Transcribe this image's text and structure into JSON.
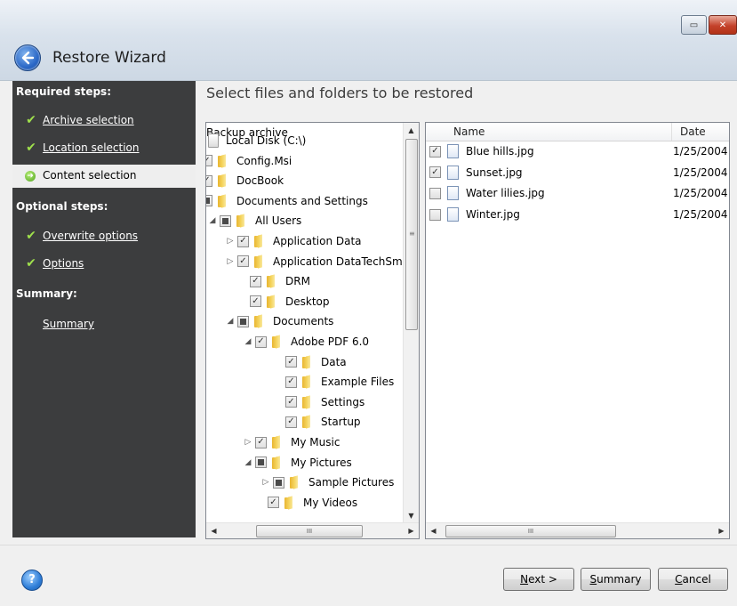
{
  "window": {
    "title": "Restore Wizard",
    "controls": [
      "minimize",
      "close"
    ]
  },
  "sidebar": {
    "required_heading": "Required steps:",
    "required_items": [
      {
        "label": "Archive selection",
        "status": "done"
      },
      {
        "label": "Location selection",
        "status": "done"
      },
      {
        "label": "Content selection",
        "status": "current"
      }
    ],
    "optional_heading": "Optional steps:",
    "optional_items": [
      {
        "label": "Overwrite options",
        "status": "done"
      },
      {
        "label": "Options",
        "status": "done"
      }
    ],
    "summary_heading": "Summary:",
    "summary_link": "Summary"
  },
  "content": {
    "title": "Select files and folders to be restored"
  },
  "tree": {
    "rows": [
      {
        "label": "Backup archive",
        "icon": "none",
        "check": "none",
        "expander": "none"
      },
      {
        "label": "Local Disk (C:\\)",
        "icon": "disk-icon",
        "check": "none",
        "expander": "none"
      },
      {
        "label": "Config.Msi",
        "icon": "folder-icon",
        "check": "checked",
        "expander": "none"
      },
      {
        "label": "DocBook",
        "icon": "folder-icon",
        "check": "checked",
        "expander": "none"
      },
      {
        "label": "Documents and Settings",
        "icon": "folder-icon",
        "check": "partial",
        "expander": "none"
      },
      {
        "label": "All Users",
        "icon": "folder-icon",
        "check": "partial",
        "expander": "expanded"
      },
      {
        "label": "Application Data",
        "icon": "folder-icon",
        "check": "checked",
        "expander": "collapsed"
      },
      {
        "label": "Application DataTechSm",
        "icon": "folder-icon",
        "check": "checked",
        "expander": "collapsed"
      },
      {
        "label": "DRM",
        "icon": "folder-icon",
        "check": "checked",
        "expander": "none"
      },
      {
        "label": "Desktop",
        "icon": "folder-icon",
        "check": "checked",
        "expander": "none"
      },
      {
        "label": "Documents",
        "icon": "folder-icon",
        "check": "partial",
        "expander": "expanded"
      },
      {
        "label": "Adobe PDF 6.0",
        "icon": "folder-icon",
        "check": "checked",
        "expander": "expanded"
      },
      {
        "label": "Data",
        "icon": "folder-icon",
        "check": "checked",
        "expander": "none"
      },
      {
        "label": "Example Files",
        "icon": "folder-icon",
        "check": "checked",
        "expander": "none"
      },
      {
        "label": "Settings",
        "icon": "folder-icon",
        "check": "checked",
        "expander": "none"
      },
      {
        "label": "Startup",
        "icon": "folder-icon",
        "check": "checked",
        "expander": "none"
      },
      {
        "label": "My Music",
        "icon": "folder-icon",
        "check": "checked",
        "expander": "collapsed"
      },
      {
        "label": "My Pictures",
        "icon": "folder-icon",
        "check": "partial",
        "expander": "expanded"
      },
      {
        "label": "Sample Pictures",
        "icon": "folder-icon",
        "check": "partial",
        "expander": "collapsed"
      },
      {
        "label": "My Videos",
        "icon": "folder-icon",
        "check": "checked",
        "expander": "none"
      }
    ],
    "hscroll_thumb": "III"
  },
  "list": {
    "columns": [
      "Name",
      "Date"
    ],
    "rows": [
      {
        "name": "Blue hills.jpg",
        "date": "1/25/2004 :",
        "checked": true
      },
      {
        "name": "Sunset.jpg",
        "date": "1/25/2004 :",
        "checked": true
      },
      {
        "name": "Water lilies.jpg",
        "date": "1/25/2004 :",
        "checked": false
      },
      {
        "name": "Winter.jpg",
        "date": "1/25/2004 :",
        "checked": false
      }
    ],
    "hscroll_thumb": "III"
  },
  "buttons": {
    "next": {
      "mnemonic": "N",
      "rest": "ext >"
    },
    "summary": {
      "mnemonic": "S",
      "rest": "ummary"
    },
    "cancel": {
      "mnemonic": "C",
      "rest": "ancel"
    },
    "help": "?"
  },
  "colors": {
    "sidebar_bg": "#3c3d3e",
    "check_green": "#9fe04c",
    "selected_bg": "#eeeeee"
  }
}
